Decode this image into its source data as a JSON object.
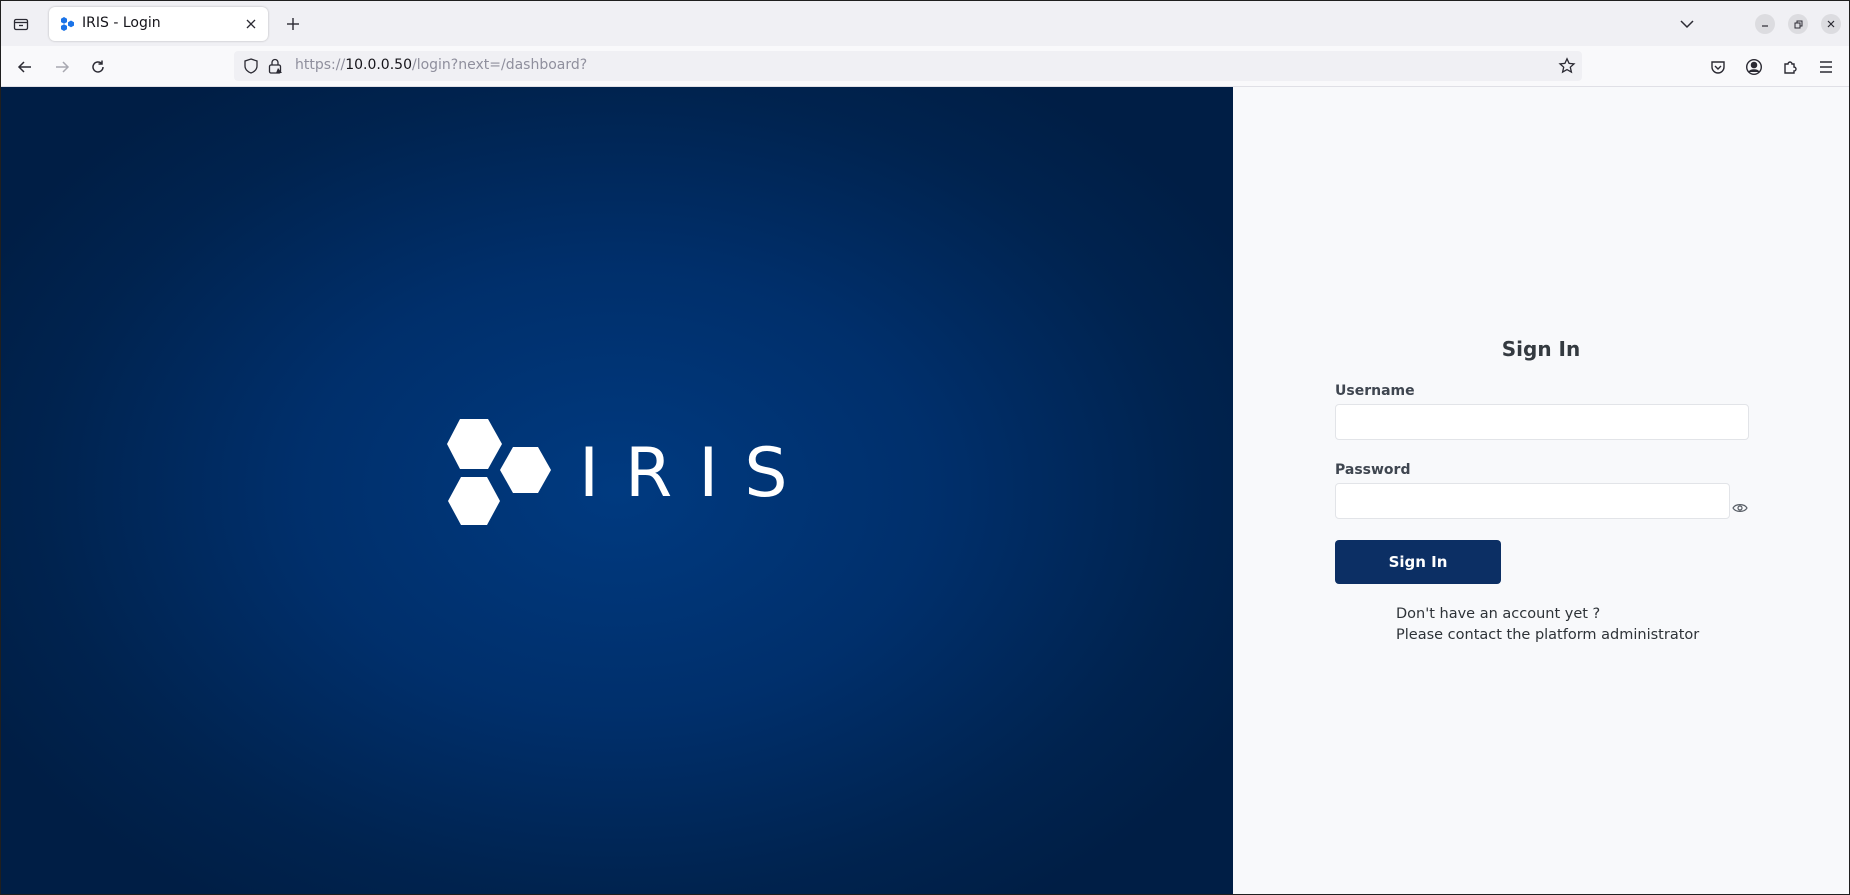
{
  "browser": {
    "tab": {
      "title": "IRIS - Login"
    },
    "urlbar": {
      "prefix": "https://",
      "host": "10.0.0.50",
      "path": "/login?next=/dashboard?"
    },
    "icons": {
      "tab_list": "tab-list-icon",
      "favicon": "iris-favicon-icon",
      "close": "close-icon",
      "new_tab": "plus-icon",
      "list_all_tabs": "chevron-down-icon",
      "minimize": "minimize-icon",
      "restore": "restore-icon",
      "window_close": "close-icon",
      "back": "arrow-left-icon",
      "forward": "arrow-right-icon",
      "reload": "reload-icon",
      "shield": "shield-icon",
      "lock": "lock-icon",
      "bookmark": "star-icon",
      "pocket": "pocket-icon",
      "account": "account-icon",
      "extensions": "puzzle-icon",
      "menu": "hamburger-menu-icon"
    }
  },
  "hero": {
    "brand": "IRIS",
    "brand_color": "#ffffff",
    "background_color": "#002f6b"
  },
  "login": {
    "title": "Sign In",
    "username_label": "Username",
    "username_value": "",
    "password_label": "Password",
    "password_value": "",
    "submit_label": "Sign In",
    "submit_color": "#0c2f64",
    "help_line1": "Don't have an account yet ?",
    "help_line2": "Please contact the platform administrator",
    "show_password_icon": "eye-icon"
  }
}
